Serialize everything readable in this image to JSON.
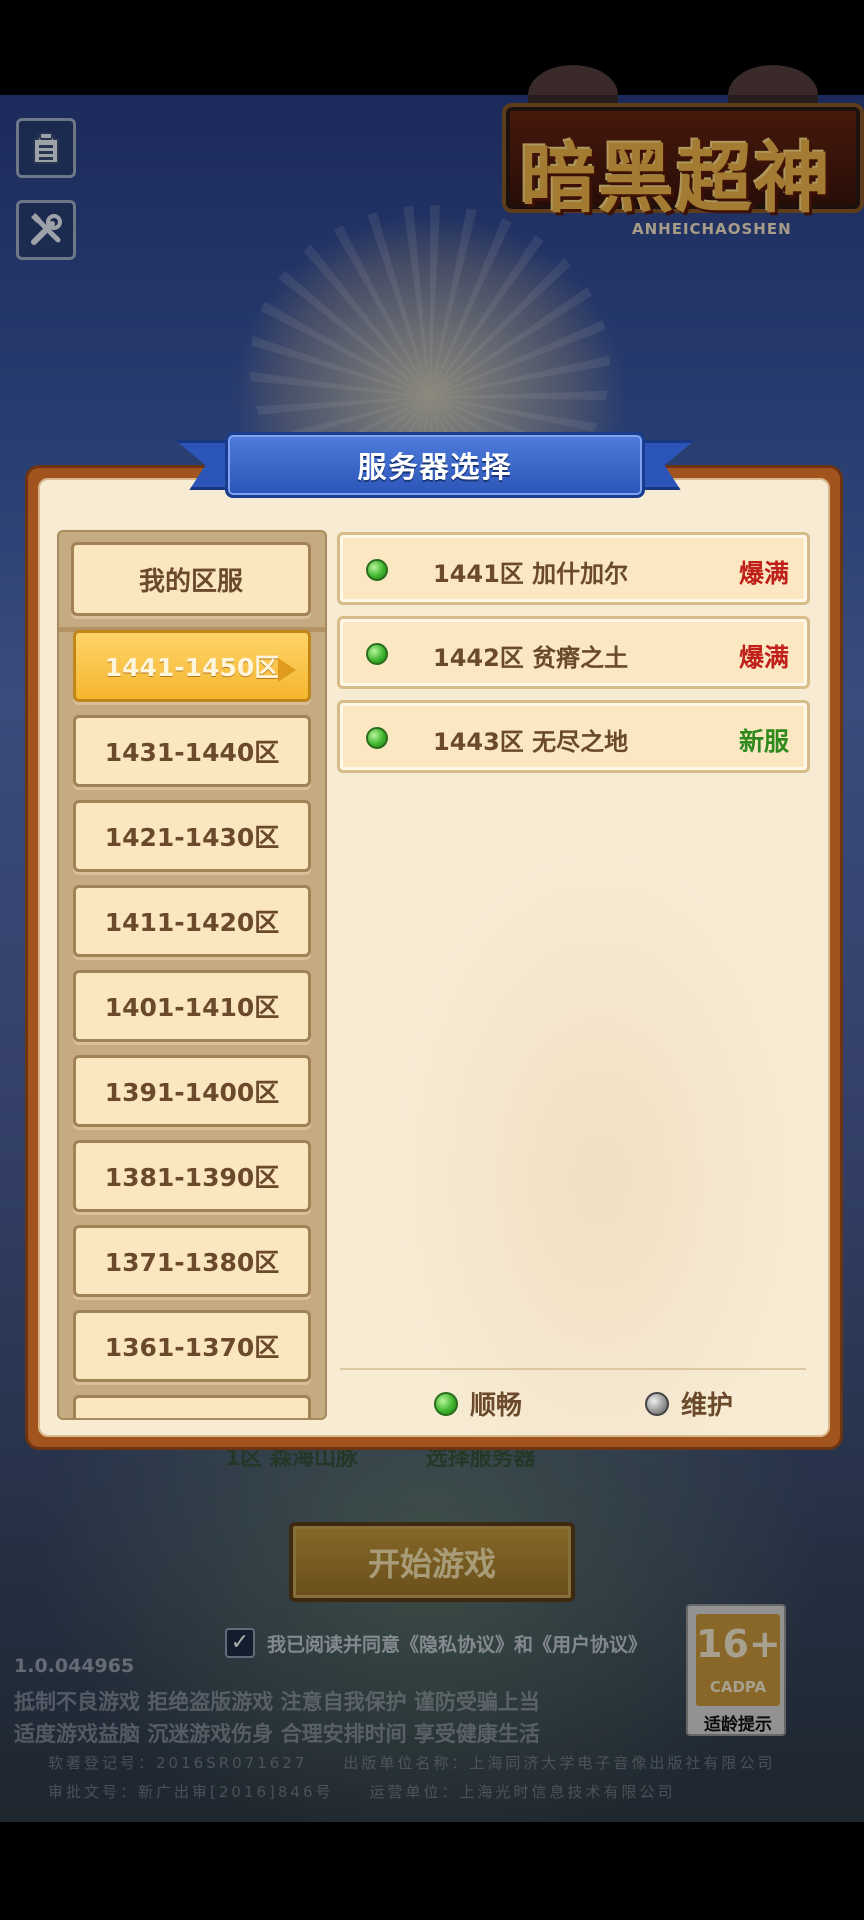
{
  "logo": {
    "title": "暗黑超神",
    "subtitle": "ANHEICHAOSHEN"
  },
  "panel": {
    "title": "服务器选择"
  },
  "zones": {
    "my_zone_label": "我的区服",
    "items": [
      {
        "label": "1441-1450区",
        "active": true
      },
      {
        "label": "1431-1440区",
        "active": false
      },
      {
        "label": "1421-1430区",
        "active": false
      },
      {
        "label": "1411-1420区",
        "active": false
      },
      {
        "label": "1401-1410区",
        "active": false
      },
      {
        "label": "1391-1400区",
        "active": false
      },
      {
        "label": "1381-1390区",
        "active": false
      },
      {
        "label": "1371-1380区",
        "active": false
      },
      {
        "label": "1361-1370区",
        "active": false
      }
    ]
  },
  "servers": [
    {
      "name": "1441区 加什加尔",
      "status": "爆满",
      "status_color": "#c0201a"
    },
    {
      "name": "1442区 贫瘠之土",
      "status": "爆满",
      "status_color": "#c0201a"
    },
    {
      "name": "1443区 无尽之地",
      "status": "新服",
      "status_color": "#2f8a1e"
    }
  ],
  "legend": {
    "smooth": "顺畅",
    "maintenance": "维护"
  },
  "background": {
    "current_server": "1区 森海山脉",
    "change_server": "选择服务器",
    "start_button": "开始游戏",
    "agree_text": "我已阅读并同意《隐私协议》和《用户协议》",
    "version": "1.0.044965",
    "health_line1": "抵制不良游戏 拒绝盗版游戏 注意自我保护 谨防受骗上当",
    "health_line2": "适度游戏益脑 沉迷游戏伤身 合理安排时间 享受健康生活",
    "legal_line1": "软著登记号：2016SR071627　　出版单位名称：上海同济大学电子音像出版社有限公司",
    "legal_line2": "审批文号：新广出审[2016]846号　　运营单位：上海光时信息技术有限公司",
    "age_rating": "16+",
    "age_code": "CADPA",
    "age_tip": "适龄提示"
  }
}
